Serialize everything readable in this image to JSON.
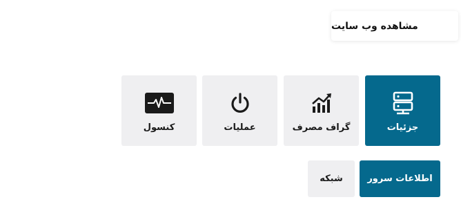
{
  "header": {
    "view_site_label": "مشاهده وب سایت"
  },
  "tiles": [
    {
      "label": "جزئیات",
      "icon": "server-icon",
      "active": true
    },
    {
      "label": "گراف مصرف",
      "icon": "usage-chart-icon",
      "active": false
    },
    {
      "label": "عملیات",
      "icon": "power-icon",
      "active": false
    },
    {
      "label": "کنسول",
      "icon": "console-icon",
      "active": false
    }
  ],
  "tabs": [
    {
      "label": "اطلاعات سرور",
      "active": true
    },
    {
      "label": "شبکه",
      "active": false
    }
  ],
  "colors": {
    "accent": "#05698d",
    "tile_background": "#efeff1",
    "text_dark": "#1a1a1a"
  }
}
